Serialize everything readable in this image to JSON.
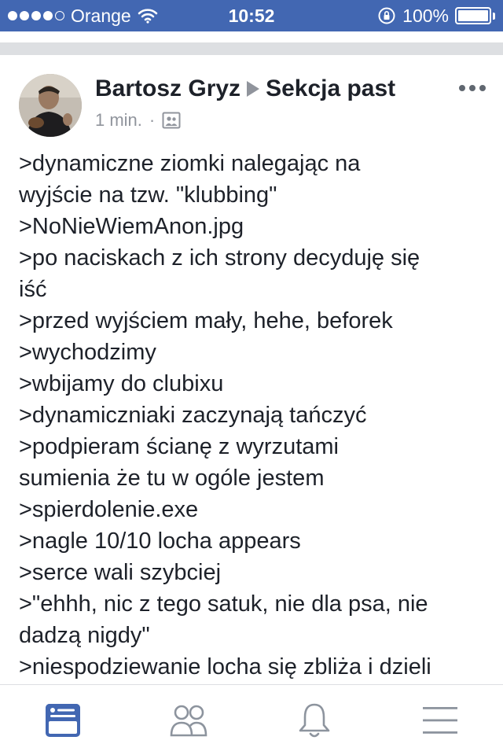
{
  "status_bar": {
    "carrier": "Orange",
    "time": "10:52",
    "battery": "100%",
    "signal_icon": "signal-dots-icon",
    "wifi_icon": "wifi-icon",
    "lock_icon": "rotation-lock-icon"
  },
  "post": {
    "author": "Bartosz Gryz",
    "group": "Sekcja past",
    "time": "1 min.",
    "separator": "·",
    "audience_icon": "group-icon",
    "more_icon": "more-options-icon",
    "lines": [
      ">dynamiczne ziomki nalegając na",
      "wyjście na tzw. \"klubbing\"",
      ">NoNieWiemAnon.jpg",
      ">po naciskach z ich strony decyduję się",
      "iść",
      ">przed wyjściem mały, hehe, beforek",
      ">wychodzimy",
      ">wbijamy do clubixu",
      ">dynamiczniaki zaczynają tańczyć",
      ">podpieram ścianę z wyrzutami",
      "sumienia że tu w ogóle jestem",
      ">spierdolenie.exe",
      ">nagle 10/10 locha appears",
      ">serce wali szybciej",
      ">\"ehhh, nic z tego satuk, nie dla psa, nie",
      "dadzą nigdy\"",
      ">niespodziewanie locha się zbliża i dzieli"
    ]
  },
  "tab_bar": {
    "tabs": [
      {
        "icon": "news-feed-icon",
        "active": true
      },
      {
        "icon": "friends-icon",
        "active": false
      },
      {
        "icon": "notifications-bell-icon",
        "active": false
      },
      {
        "icon": "menu-icon",
        "active": false
      }
    ],
    "active_color": "#4267b2",
    "inactive_color": "#8d949e"
  }
}
